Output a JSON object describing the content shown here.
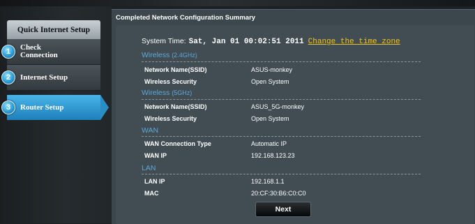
{
  "sidebar": {
    "header": "Quick Internet Setup",
    "steps": [
      {
        "num": "1",
        "label": "Check Connection",
        "line1": "Check",
        "line2": "Connection"
      },
      {
        "num": "2",
        "label": "Internet Setup"
      },
      {
        "num": "3",
        "label": "Router Setup"
      }
    ],
    "active_step": 3
  },
  "main": {
    "title": "Completed Network Configuration Summary",
    "system_time_label": "System Time:",
    "system_time_value": "Sat, Jan 01 00:02:51 2011",
    "change_tz_link": "Change the time zone",
    "sections": [
      {
        "name": "Wireless",
        "sub": "(2.4GHz)",
        "rows": [
          {
            "label": "Network Name(SSID)",
            "value": "ASUS-monkey"
          },
          {
            "label": "Wireless Security",
            "value": "Open System"
          }
        ]
      },
      {
        "name": "Wireless",
        "sub": "(5GHz)",
        "rows": [
          {
            "label": "Network Name(SSID)",
            "value": "ASUS_5G-monkey"
          },
          {
            "label": "Wireless Security",
            "value": "Open System"
          }
        ]
      },
      {
        "name": "WAN",
        "sub": "",
        "rows": [
          {
            "label": "WAN Connection Type",
            "value": "Automatic IP"
          },
          {
            "label": "WAN IP",
            "value": "192.168.123.23"
          }
        ]
      },
      {
        "name": "LAN",
        "sub": "",
        "rows": [
          {
            "label": "LAN IP",
            "value": "192.168.1.1"
          },
          {
            "label": "MAC",
            "value": "20:CF:30:B6:C0:C0"
          }
        ]
      }
    ],
    "next_label": "Next"
  },
  "colors": {
    "accent_blue": "#2a8dc6",
    "section_title": "#5fa8d8",
    "link_yellow": "#f2c21d",
    "panel": "#414d53"
  }
}
